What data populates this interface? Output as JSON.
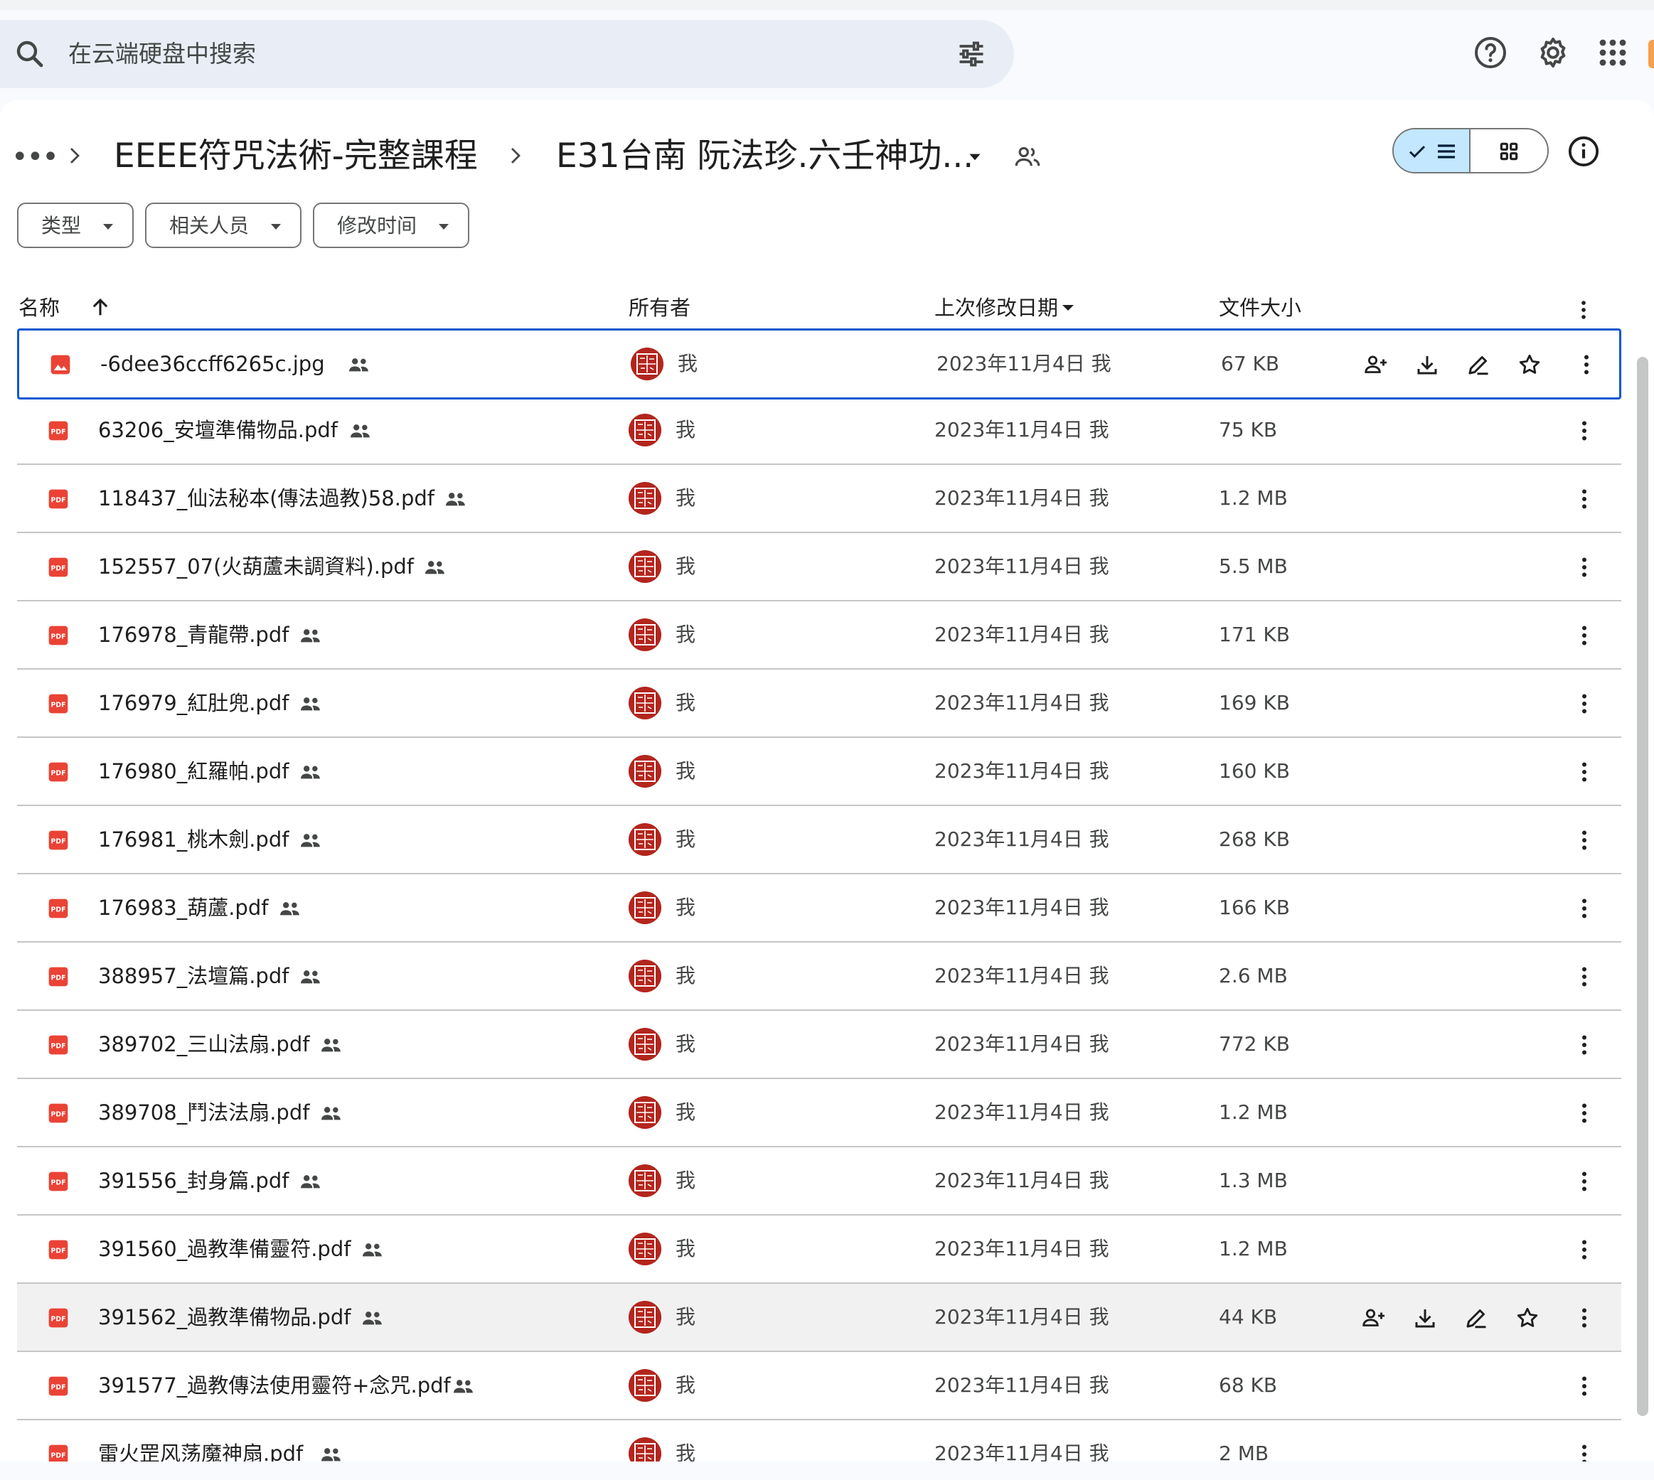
{
  "search": {
    "placeholder": "在云端硬盘中搜索"
  },
  "breadcrumb": {
    "more": "•••",
    "items": [
      "EEEE符咒法術-完整課程",
      "E31台南 阮法珍.六壬神功..."
    ]
  },
  "filters": [
    "类型",
    "相关人员",
    "修改时间"
  ],
  "columns": {
    "name": "名称",
    "owner": "所有者",
    "modified": "上次修改日期",
    "size": "文件大小"
  },
  "colors": {
    "accent": "#0b57d0",
    "pdf_red": "#ea4335",
    "toggle_bg": "#c2e7ff",
    "search_bg": "#e9eef6"
  },
  "files": [
    {
      "name": "-6dee36ccff6265c.jpg",
      "type": "image",
      "owner": "我",
      "modified": "2023年11月4日 我",
      "size": "67 KB",
      "state": "selected"
    },
    {
      "name": "63206_安壇準備物品.pdf",
      "type": "pdf",
      "owner": "我",
      "modified": "2023年11月4日 我",
      "size": "75 KB",
      "state": ""
    },
    {
      "name": "118437_仙法秘本(傳法過教)58.pdf",
      "type": "pdf",
      "owner": "我",
      "modified": "2023年11月4日 我",
      "size": "1.2 MB",
      "state": ""
    },
    {
      "name": "152557_07(火葫蘆未調資料).pdf",
      "type": "pdf",
      "owner": "我",
      "modified": "2023年11月4日 我",
      "size": "5.5 MB",
      "state": ""
    },
    {
      "name": "176978_青龍帶.pdf",
      "type": "pdf",
      "owner": "我",
      "modified": "2023年11月4日 我",
      "size": "171 KB",
      "state": ""
    },
    {
      "name": "176979_紅肚兜.pdf",
      "type": "pdf",
      "owner": "我",
      "modified": "2023年11月4日 我",
      "size": "169 KB",
      "state": ""
    },
    {
      "name": "176980_紅羅帕.pdf",
      "type": "pdf",
      "owner": "我",
      "modified": "2023年11月4日 我",
      "size": "160 KB",
      "state": ""
    },
    {
      "name": "176981_桃木劍.pdf",
      "type": "pdf",
      "owner": "我",
      "modified": "2023年11月4日 我",
      "size": "268 KB",
      "state": ""
    },
    {
      "name": "176983_葫蘆.pdf",
      "type": "pdf",
      "owner": "我",
      "modified": "2023年11月4日 我",
      "size": "166 KB",
      "state": ""
    },
    {
      "name": "388957_法壇篇.pdf",
      "type": "pdf",
      "owner": "我",
      "modified": "2023年11月4日 我",
      "size": "2.6 MB",
      "state": ""
    },
    {
      "name": "389702_三山法扇.pdf",
      "type": "pdf",
      "owner": "我",
      "modified": "2023年11月4日 我",
      "size": "772 KB",
      "state": ""
    },
    {
      "name": "389708_鬥法法扇.pdf",
      "type": "pdf",
      "owner": "我",
      "modified": "2023年11月4日 我",
      "size": "1.2 MB",
      "state": ""
    },
    {
      "name": "391556_封身篇.pdf",
      "type": "pdf",
      "owner": "我",
      "modified": "2023年11月4日 我",
      "size": "1.3 MB",
      "state": ""
    },
    {
      "name": "391560_過教準備靈符.pdf",
      "type": "pdf",
      "owner": "我",
      "modified": "2023年11月4日 我",
      "size": "1.2 MB",
      "state": ""
    },
    {
      "name": "391562_過教準備物品.pdf",
      "type": "pdf",
      "owner": "我",
      "modified": "2023年11月4日 我",
      "size": "44 KB",
      "state": "hover"
    },
    {
      "name": "391577_過教傳法使用靈符+念咒.pdf",
      "type": "pdf",
      "owner": "我",
      "modified": "2023年11月4日 我",
      "size": "68 KB",
      "state": ""
    },
    {
      "name": "雷火罡风荡魔神扇.pdf",
      "type": "pdf",
      "owner": "我",
      "modified": "2023年11月4日 我",
      "size": "2 MB",
      "state": ""
    }
  ]
}
